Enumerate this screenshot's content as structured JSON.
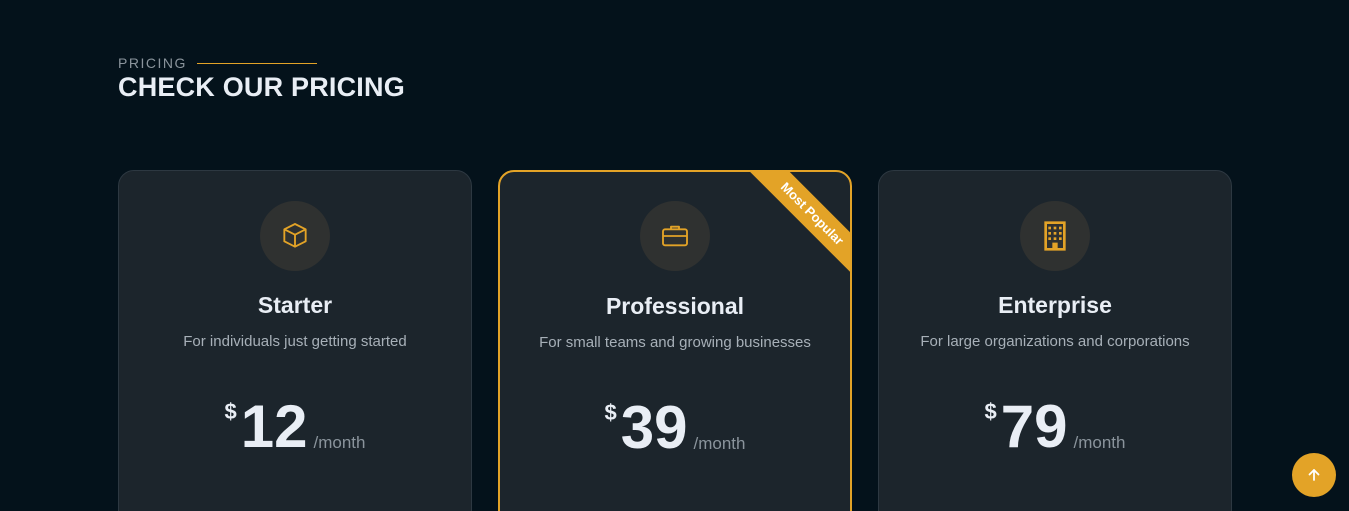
{
  "header": {
    "eyebrow": "PRICING",
    "title": "CHECK OUR PRICING"
  },
  "plans": [
    {
      "icon": "box-icon",
      "name": "Starter",
      "description": "For individuals just getting started",
      "currency": "$",
      "amount": "12",
      "period": "/month",
      "featured": false
    },
    {
      "icon": "briefcase-icon",
      "name": "Professional",
      "description": "For small teams and growing businesses",
      "currency": "$",
      "amount": "39",
      "period": "/month",
      "featured": true,
      "ribbon": "Most Popular"
    },
    {
      "icon": "building-icon",
      "name": "Enterprise",
      "description": "For large organizations and corporations",
      "currency": "$",
      "amount": "79",
      "period": "/month",
      "featured": false
    }
  ],
  "back_to_top": {
    "icon": "arrow-up-icon"
  },
  "colors": {
    "background": "#04121b",
    "card": "#1c252c",
    "accent": "#e3a327",
    "text": "#e9eef5",
    "muted": "#a7b0b8"
  }
}
